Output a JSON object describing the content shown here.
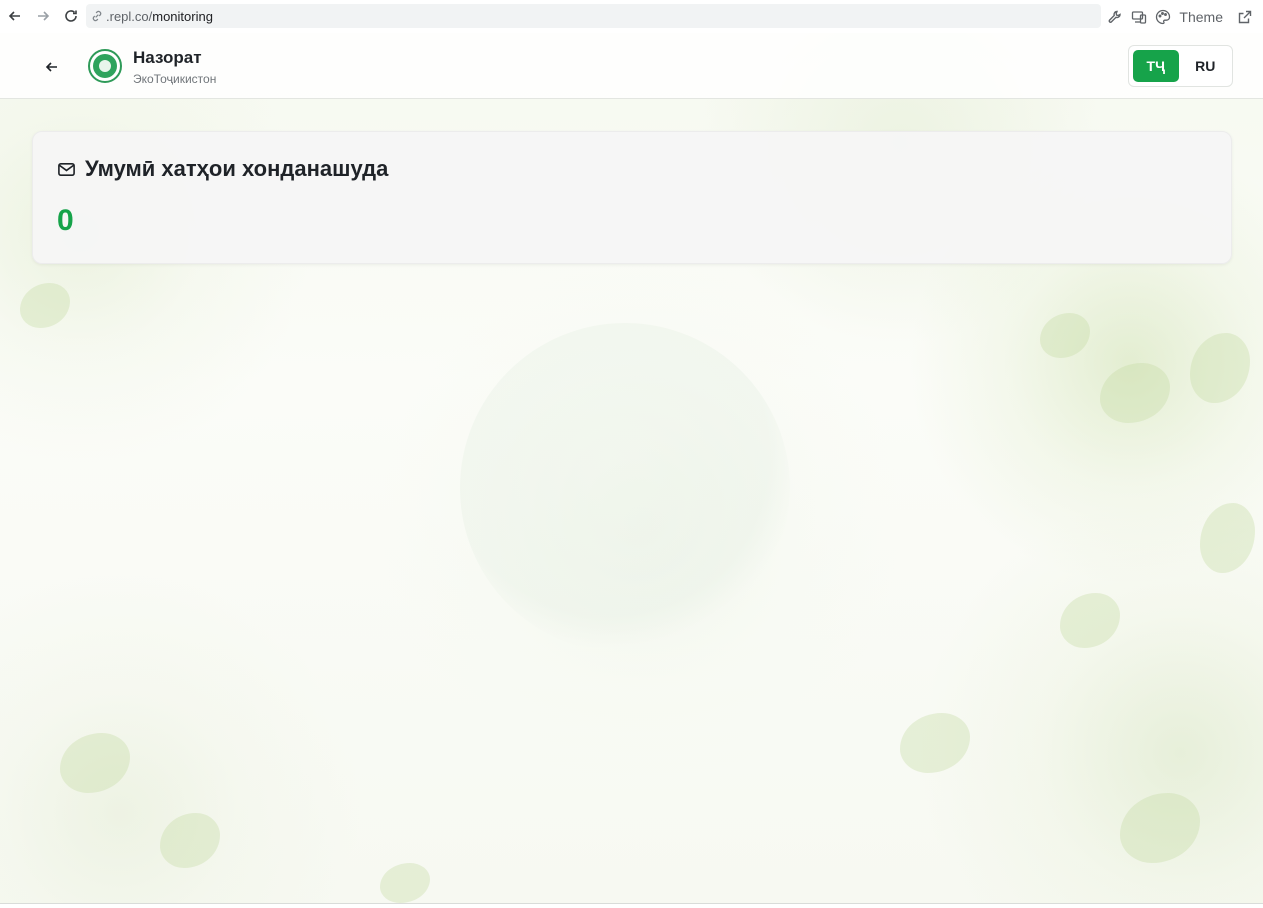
{
  "browser": {
    "url_host": ".repl.co/",
    "url_path": "monitoring",
    "theme_label": "Theme"
  },
  "header": {
    "title": "Назорат",
    "subtitle": "ЭкоТоҷикистон",
    "languages": [
      {
        "label": "ТҶ",
        "active": true
      },
      {
        "label": "RU",
        "active": false
      }
    ]
  },
  "card": {
    "icon": "mail-icon",
    "title": "Умумӣ хатҳои хонданашуда",
    "value": "0"
  },
  "colors": {
    "accent": "#16a34a",
    "text": "#1f2328"
  }
}
